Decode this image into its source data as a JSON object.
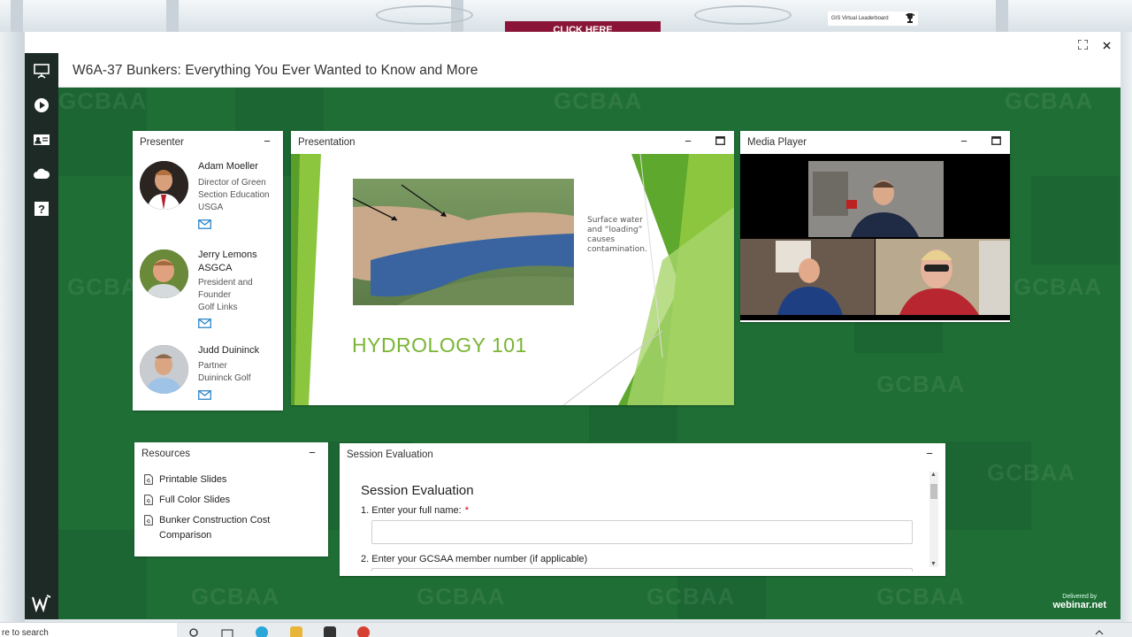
{
  "background": {
    "banner_text": "CLICK HERE",
    "leaderboard_label": "GIS Virtual Leaderboard"
  },
  "window": {
    "title": "W6A-37 Bunkers: Everything You Ever Wanted to Know and More"
  },
  "presenter_panel": {
    "title": "Presenter",
    "presenters": [
      {
        "name": "Adam Moeller",
        "org": "",
        "title_lines": [
          "Director of Green",
          "Section Education",
          "USGA"
        ]
      },
      {
        "name": "Jerry Lemons",
        "org": "ASGCA",
        "title_lines": [
          "President and",
          "Founder",
          "Golf Links"
        ]
      },
      {
        "name": "Judd Duininck",
        "org": "",
        "title_lines": [
          "Partner",
          "Duininck Golf"
        ]
      }
    ]
  },
  "presentation_panel": {
    "title": "Presentation",
    "slide_title": "HYDROLOGY 101",
    "slide_caption": "Surface water and “loading” causes contamination."
  },
  "media_panel": {
    "title": "Media Player"
  },
  "resources_panel": {
    "title": "Resources",
    "items": [
      "Printable Slides",
      "Full Color Slides",
      "Bunker Construction Cost Comparison"
    ]
  },
  "evaluation_panel": {
    "title": "Session Evaluation",
    "heading": "Session Evaluation",
    "questions": [
      {
        "label": "1. Enter your full name:",
        "required_mark": "*"
      },
      {
        "label": "2. Enter your GCSAA member number (if applicable)",
        "required_mark": ""
      }
    ]
  },
  "watermark": "GCBAA",
  "branding": {
    "delivered_by": "Delivered by",
    "brand": "webinar.net"
  },
  "taskbar": {
    "search_text": "re to search"
  },
  "colors": {
    "stage_green": "#1f6e35",
    "rail_dark": "#1d2a26",
    "slide_green": "#7ab535",
    "link_blue": "#2a86c8"
  }
}
